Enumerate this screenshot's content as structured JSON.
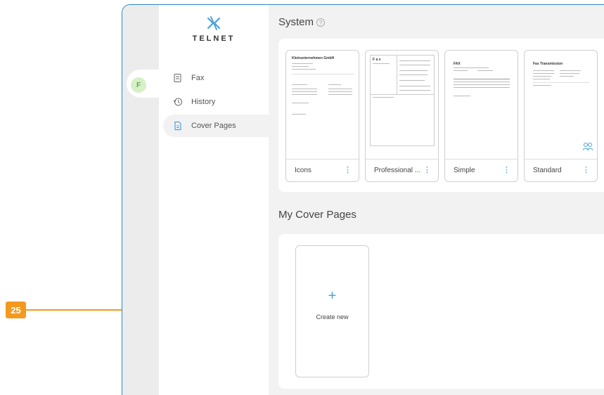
{
  "callout": {
    "number": "25"
  },
  "brand": {
    "name": "TELNET"
  },
  "user": {
    "initial": "F"
  },
  "nav": {
    "items": [
      {
        "label": "Fax",
        "icon": "fax-icon"
      },
      {
        "label": "History",
        "icon": "history-icon"
      },
      {
        "label": "Cover Pages",
        "icon": "document-icon"
      }
    ]
  },
  "system": {
    "title": "System",
    "help_glyph": "?",
    "cards": [
      {
        "name": "Icons"
      },
      {
        "name": "Professional ..."
      },
      {
        "name": "Simple"
      },
      {
        "name": "Standard"
      }
    ]
  },
  "my_cover_pages": {
    "title": "My Cover Pages",
    "create_plus": "+",
    "create_label": "Create new"
  },
  "thumbnails": {
    "icons_title": "Kleinunternehmen GmbH",
    "fax_title": "FAX",
    "standard_title": "Fax Transmission",
    "professional_title": "F a x"
  },
  "more_glyph": "⋮",
  "colors": {
    "accent": "#4ba3dc",
    "callout": "#f39a1e",
    "frame": "#2e89c9",
    "avatar_bg": "#d5efc7"
  }
}
